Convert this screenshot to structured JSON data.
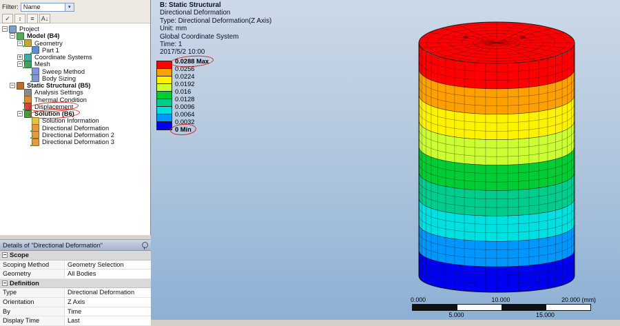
{
  "outline": {
    "filter_label": "Filter:",
    "filter_value": "Name",
    "toolbar_icons": [
      {
        "name": "filter-check-icon",
        "glyph": "✓"
      },
      {
        "name": "expand-collapse-icon",
        "glyph": "↕"
      },
      {
        "name": "list-view-icon",
        "glyph": "≡"
      },
      {
        "name": "sort-az-icon",
        "glyph": "A↓"
      }
    ],
    "tree": [
      {
        "label": "Project",
        "depth": 0,
        "exp": "-",
        "icon": "project-icon",
        "color": "#7aa0c8",
        "check": false,
        "bold": false,
        "circled": false
      },
      {
        "label": "Model (B4)",
        "depth": 1,
        "exp": "-",
        "icon": "model-icon",
        "color": "#55aa55",
        "check": false,
        "bold": true,
        "circled": false
      },
      {
        "label": "Geometry",
        "depth": 2,
        "exp": "-",
        "icon": "geometry-icon",
        "color": "#c8a43c",
        "check": true,
        "bold": false,
        "circled": false
      },
      {
        "label": "Part 1",
        "depth": 3,
        "exp": "",
        "icon": "part-icon",
        "color": "#5b8dd6",
        "check": true,
        "bold": false,
        "circled": false
      },
      {
        "label": "Coordinate Systems",
        "depth": 2,
        "exp": "+",
        "icon": "coordinate-systems-icon",
        "color": "#46a9a9",
        "check": true,
        "bold": false,
        "circled": false
      },
      {
        "label": "Mesh",
        "depth": 2,
        "exp": "-",
        "icon": "mesh-icon",
        "color": "#3fa05f",
        "check": true,
        "bold": false,
        "circled": false
      },
      {
        "label": "Sweep Method",
        "depth": 3,
        "exp": "",
        "icon": "sweep-method-icon",
        "color": "#7f95d8",
        "check": true,
        "bold": false,
        "circled": false
      },
      {
        "label": "Body Sizing",
        "depth": 3,
        "exp": "",
        "icon": "body-sizing-icon",
        "color": "#7f95d8",
        "check": true,
        "bold": false,
        "circled": false
      },
      {
        "label": "Static Structural (B5)",
        "depth": 1,
        "exp": "-",
        "icon": "static-structural-icon",
        "color": "#b8702f",
        "check": false,
        "bold": true,
        "circled": false
      },
      {
        "label": "Analysis Settings",
        "depth": 2,
        "exp": "",
        "icon": "analysis-settings-icon",
        "color": "#8a8a8a",
        "check": false,
        "bold": false,
        "circled": false
      },
      {
        "label": "Thermal Condition",
        "depth": 2,
        "exp": "",
        "icon": "thermal-condition-icon",
        "color": "#e0892f",
        "check": true,
        "bold": false,
        "circled": false
      },
      {
        "label": "Displacement",
        "depth": 2,
        "exp": "",
        "icon": "displacement-icon",
        "color": "#cc4444",
        "check": true,
        "bold": false,
        "circled": true
      },
      {
        "label": "Solution (B6)",
        "depth": 2,
        "exp": "-",
        "icon": "solution-icon",
        "color": "#3fa03f",
        "check": false,
        "bold": true,
        "circled": true
      },
      {
        "label": "Solution Information",
        "depth": 3,
        "exp": "",
        "icon": "solution-information-icon",
        "color": "#e3c43c",
        "check": false,
        "bold": false,
        "circled": false
      },
      {
        "label": "Directional Deformation",
        "depth": 3,
        "exp": "",
        "icon": "result-icon",
        "color": "#e39b3c",
        "check": true,
        "bold": false,
        "circled": false
      },
      {
        "label": "Directional Deformation 2",
        "depth": 3,
        "exp": "",
        "icon": "result-icon",
        "color": "#e39b3c",
        "check": true,
        "bold": false,
        "circled": false
      },
      {
        "label": "Directional Deformation 3",
        "depth": 3,
        "exp": "",
        "icon": "result-icon",
        "color": "#e39b3c",
        "check": true,
        "bold": false,
        "circled": false
      }
    ]
  },
  "details": {
    "title": "Details of \"Directional Deformation\"",
    "rows": [
      {
        "type": "section",
        "label": "Scope"
      },
      {
        "type": "kv",
        "key": "Scoping Method",
        "value": "Geometry Selection"
      },
      {
        "type": "kv",
        "key": "Geometry",
        "value": "All Bodies"
      },
      {
        "type": "section",
        "label": "Definition"
      },
      {
        "type": "kv",
        "key": "Type",
        "value": "Directional Deformation"
      },
      {
        "type": "kv",
        "key": "Orientation",
        "value": "Z Axis"
      },
      {
        "type": "kv",
        "key": "By",
        "value": "Time"
      },
      {
        "type": "kv",
        "key": "Display Time",
        "value": "Last"
      }
    ]
  },
  "viewport": {
    "header_lines": [
      "B: Static Structural",
      "Directional Deformation",
      "Type: Directional Deformation(Z Axis)",
      "Unit: mm",
      "Global Coordinate System",
      "Time: 1",
      "2017/5/2 10:00"
    ],
    "legend": {
      "values": [
        {
          "text": "0.0288 Max",
          "bold": true,
          "circled": true
        },
        {
          "text": "0.0256",
          "bold": false,
          "circled": false
        },
        {
          "text": "0.0224",
          "bold": false,
          "circled": false
        },
        {
          "text": "0.0192",
          "bold": false,
          "circled": false
        },
        {
          "text": "0.016",
          "bold": false,
          "circled": false
        },
        {
          "text": "0.0128",
          "bold": false,
          "circled": false
        },
        {
          "text": "0.0096",
          "bold": false,
          "circled": false
        },
        {
          "text": "0.0064",
          "bold": false,
          "circled": false
        },
        {
          "text": "0.0032",
          "bold": false,
          "circled": false
        },
        {
          "text": "0 Min",
          "bold": true,
          "circled": true
        }
      ],
      "colors": [
        "#ff0000",
        "#ffa000",
        "#fff200",
        "#ccff33",
        "#00cc33",
        "#00cc8c",
        "#00e0e0",
        "#0096ff",
        "#0000f0"
      ]
    },
    "ruler": {
      "top_labels": [
        "0.000",
        "10.000",
        "20.000 (mm)"
      ],
      "bottom_labels": [
        "5.000",
        "15.000"
      ]
    },
    "annotation_color": "#d32222"
  }
}
